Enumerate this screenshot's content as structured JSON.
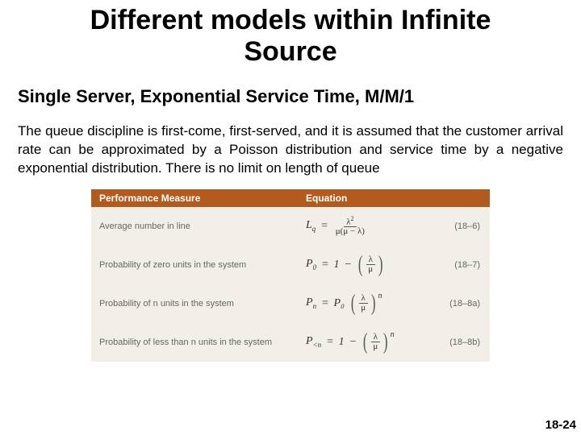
{
  "title": "Different models within Infinite Source",
  "subtitle": "Single Server, Exponential Service Time, M/M/1",
  "body": "The queue discipline is first-come, first-served, and it is assumed that the customer arrival rate can be approximated by a Poisson distribution and service time by a negative exponential distribution. There is no limit on length of queue",
  "header": {
    "measure": "Performance Measure",
    "equation": "Equation"
  },
  "rows": [
    {
      "measure": "Average number in line",
      "sym": "L",
      "sub": "q",
      "rhs": "frac_lq",
      "ref": "(18–6)"
    },
    {
      "measure": "Probability of zero units in the system",
      "sym": "P",
      "sub": "0",
      "rhs": "one_minus_lm",
      "ref": "(18–7)"
    },
    {
      "measure": "Probability of n units in the system",
      "sym": "P",
      "sub": "n",
      "rhs": "p0_lm_n",
      "ref": "(18–8a)"
    },
    {
      "measure": "Probability of less than n units in the system",
      "sym": "P",
      "sub": "<n",
      "rhs": "one_minus_lm_n",
      "ref": "(18–8b)"
    }
  ],
  "glyphs": {
    "lambda": "λ",
    "mu": "μ",
    "eq": "=",
    "minus": "−",
    "one": "1",
    "P0": "P₀",
    "n": "n",
    "sq": "2"
  },
  "footer": "18-24",
  "chart_data": {
    "type": "table",
    "title": "Performance Measure / Equation",
    "rows": [
      {
        "measure": "Average number in line",
        "symbol": "L_q",
        "equation": "λ² / (μ(μ − λ))",
        "ref": "18-6"
      },
      {
        "measure": "Probability of zero units in the system",
        "symbol": "P_0",
        "equation": "1 − (λ/μ)",
        "ref": "18-7"
      },
      {
        "measure": "Probability of n units in the system",
        "symbol": "P_n",
        "equation": "P_0 (λ/μ)^n",
        "ref": "18-8a"
      },
      {
        "measure": "Probability of less than n units in the system",
        "symbol": "P_{<n}",
        "equation": "1 − (λ/μ)^n",
        "ref": "18-8b"
      }
    ]
  }
}
